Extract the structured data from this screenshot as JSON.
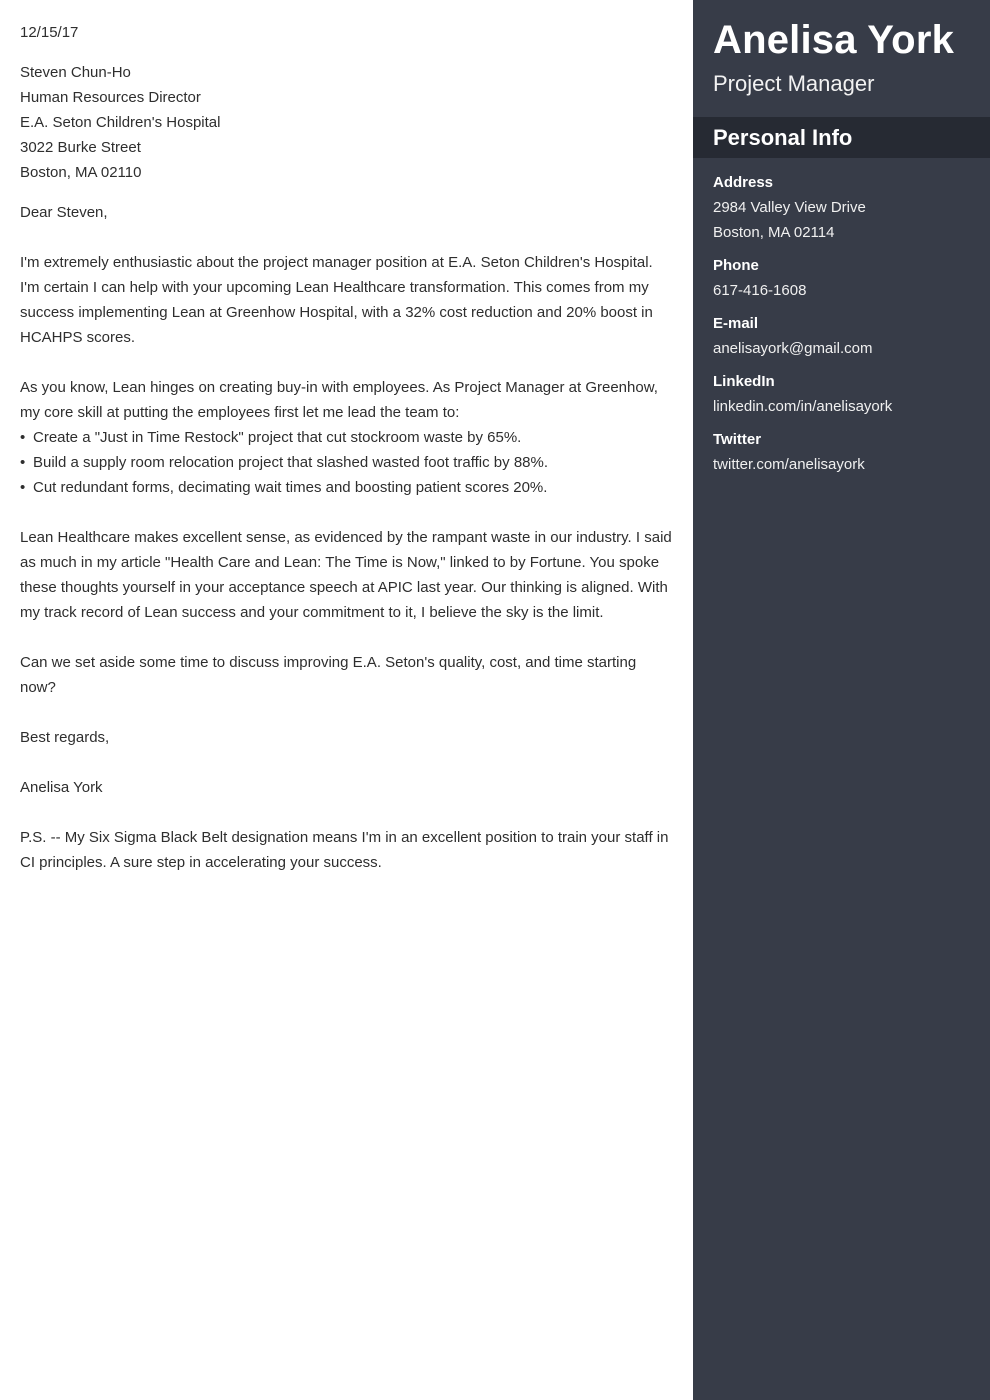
{
  "letter": {
    "date": "12/15/17",
    "recipient": [
      "Steven Chun-Ho",
      "Human Resources Director",
      "E.A. Seton Children's Hospital",
      "3022 Burke Street",
      "Boston, MA 02110"
    ],
    "salutation": "Dear Steven,",
    "paragraph1": "I'm extremely enthusiastic about the project manager position at E.A. Seton Children's Hospital. I'm certain I can help with your upcoming Lean Healthcare transformation. This comes from my success implementing Lean at Greenhow Hospital, with a 32% cost reduction and 20% boost in HCAHPS scores.",
    "paragraph2_intro": "As you know, Lean hinges on creating buy-in with employees. As Project Manager at Greenhow, my core skill at putting the employees first let me lead the team to:",
    "bullets": [
      "Create a \"Just in Time Restock\" project that cut stockroom waste by 65%.",
      "Build a supply room relocation project that slashed wasted foot traffic by 88%.",
      "Cut redundant forms, decimating wait times and boosting patient scores 20%."
    ],
    "bullet_glyph": "•",
    "paragraph3": "Lean Healthcare makes excellent sense, as evidenced by the rampant waste in our industry. I said as much in my article \"Health Care and Lean: The Time is Now,\" linked to by Fortune. You spoke these thoughts yourself in your acceptance speech at APIC last year. Our thinking is aligned. With my track record of Lean success and your commitment to it, I believe the sky is the limit.",
    "paragraph4": "Can we set aside some time to discuss improving E.A. Seton's quality, cost, and time starting now?",
    "closing": "Best regards,",
    "signature": "Anelisa York",
    "postscript": "P.S. -- My Six Sigma Black Belt designation means I'm in an excellent position to train your staff in CI principles. A sure step in accelerating your success."
  },
  "sidebar": {
    "name": "Anelisa York",
    "title": "Project Manager",
    "section_title": "Personal Info",
    "address_label": "Address",
    "address_line1": "2984 Valley View Drive",
    "address_line2": "Boston, MA 02114",
    "phone_label": "Phone",
    "phone": "617-416-1608",
    "email_label": "E-mail",
    "email": "anelisayork@gmail.com",
    "linkedin_label": "LinkedIn",
    "linkedin": "linkedin.com/in/anelisayork",
    "twitter_label": "Twitter",
    "twitter": "twitter.com/anelisayork"
  },
  "colors": {
    "sidebar_bg": "#373c48",
    "section_head_bg": "#262a33",
    "body_text": "#2e2e2e"
  }
}
